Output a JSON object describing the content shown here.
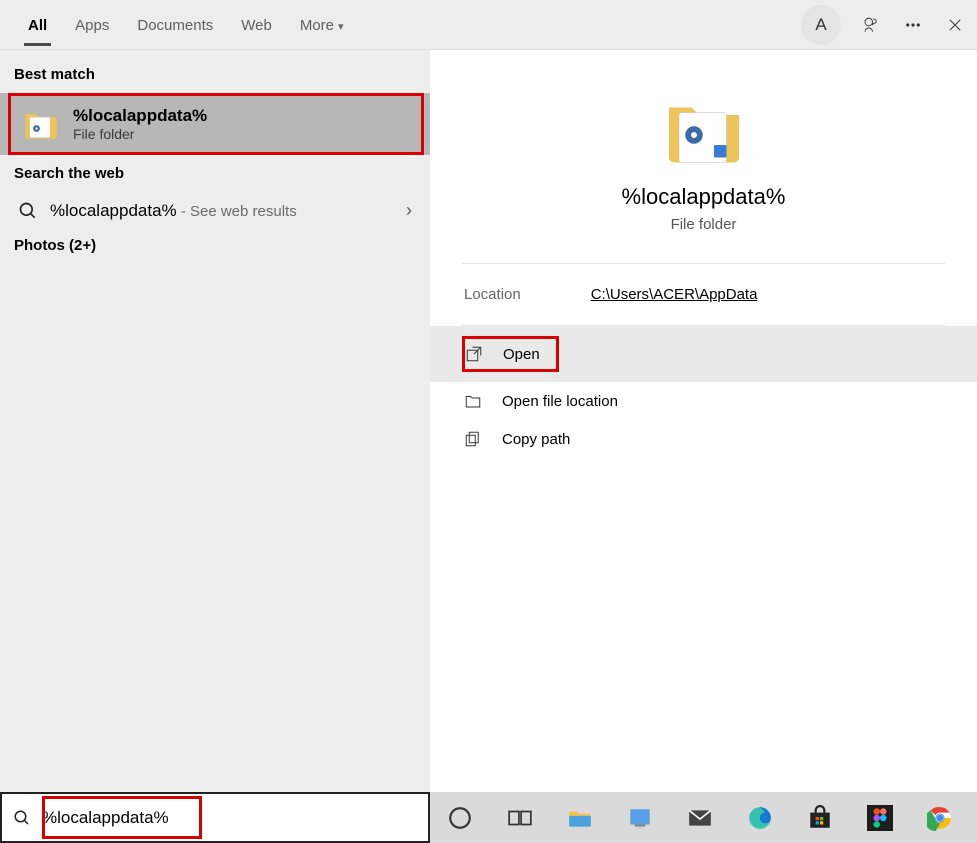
{
  "tabs": {
    "all": "All",
    "apps": "Apps",
    "documents": "Documents",
    "web": "Web",
    "more": "More"
  },
  "avatar_letter": "A",
  "sections": {
    "best_match": "Best match",
    "search_web": "Search the web",
    "photos": "Photos (2+)"
  },
  "best_match": {
    "title": "%localappdata%",
    "subtitle": "File folder"
  },
  "web_result": {
    "query": "%localappdata%",
    "suffix": " - See web results"
  },
  "preview": {
    "title": "%localappdata%",
    "subtitle": "File folder",
    "location_label": "Location",
    "location_value": "C:\\Users\\ACER\\AppData"
  },
  "actions": {
    "open": "Open",
    "open_location": "Open file location",
    "copy_path": "Copy path"
  },
  "search_value": "%localappdata%"
}
